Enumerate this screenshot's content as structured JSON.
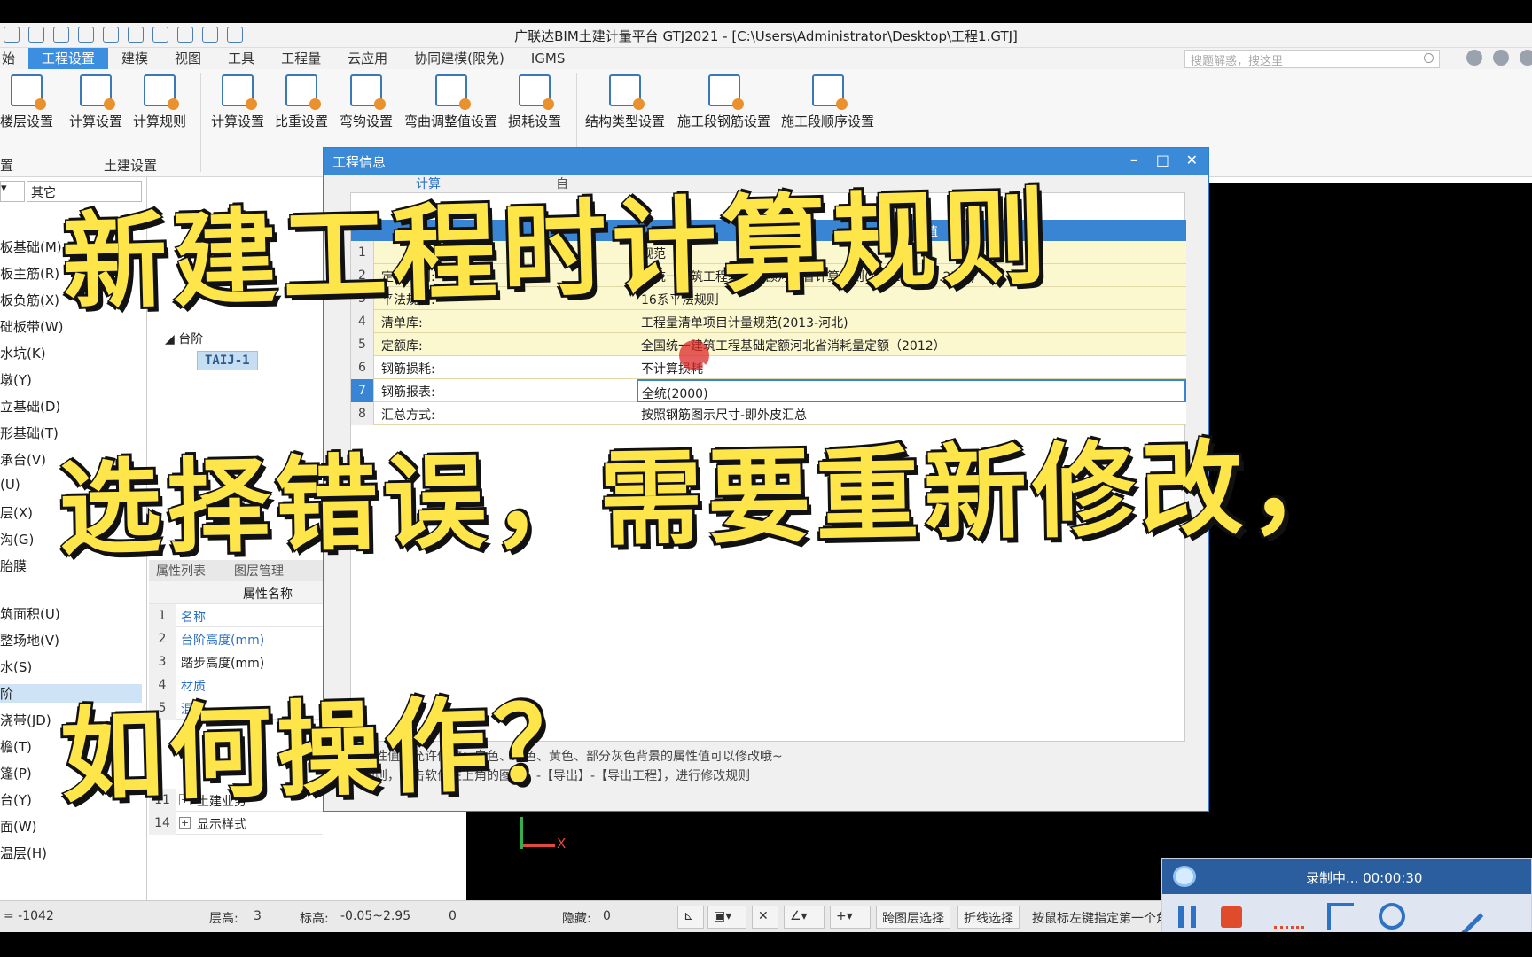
{
  "window": {
    "title": "广联达BIM土建计量平台 GTJ2021 - [C:\\Users\\Administrator\\Desktop\\工程1.GTJ]"
  },
  "menu": {
    "items": [
      "始",
      "工程设置",
      "建模",
      "视图",
      "工具",
      "工程量",
      "云应用",
      "协同建模(限免)",
      "IGMS"
    ],
    "active_index": 1
  },
  "search": {
    "placeholder": "搜题解惑，搜这里"
  },
  "ribbon": {
    "groups": [
      {
        "label": "置",
        "buttons": [
          "楼层设置"
        ]
      },
      {
        "label": "土建设置",
        "buttons": [
          "计算设置",
          "计算规则"
        ]
      },
      {
        "label": "",
        "buttons": [
          "计算设置",
          "比重设置",
          "弯钩设置",
          "弯曲调整值设置",
          "损耗设置"
        ]
      },
      {
        "label": "",
        "buttons": [
          "结构类型设置",
          "施工段钢筋设置",
          "施工段顺序设置"
        ]
      }
    ]
  },
  "left_panel": {
    "combo_value": "其它",
    "items": [
      "板基础(M)",
      "板主筋(R)",
      "板负筋(X)",
      "础板带(W)",
      "水坑(K)",
      "墩(Y)",
      "立基础(D)",
      "形基础(T)",
      "承台(V)",
      "(U)",
      "层(X)",
      "沟(G)",
      "胎膜",
      "筑面积(U)",
      "整场地(V)",
      "水(S)",
      "阶",
      "浇带(JD)",
      "檐(T)",
      "篷(P)",
      "台(Y)",
      "面(W)",
      "温层(H)"
    ],
    "selected_index": 16
  },
  "tree": {
    "parent": "台阶",
    "child": "TAIJ-1"
  },
  "properties": {
    "tabs": [
      "属性列表",
      "图层管理"
    ],
    "header": "属性名称",
    "rows": [
      {
        "num": "1",
        "text": "名称",
        "link": true
      },
      {
        "num": "2",
        "text": "台阶高度(mm)",
        "link": true
      },
      {
        "num": "3",
        "text": "踏步高度(mm)",
        "link": false
      },
      {
        "num": "4",
        "text": "材质",
        "link": true
      },
      {
        "num": "5",
        "text": "混凝",
        "link": true
      },
      {
        "num": "11",
        "text": "土建业务",
        "link": false
      },
      {
        "num": "14",
        "text": "显示样式",
        "link": false
      }
    ]
  },
  "dialog": {
    "title": "工程信息",
    "tabs": [
      "计算",
      "自"
    ],
    "column_value_label": "性值",
    "rows": [
      {
        "num": "1",
        "name": "",
        "value": "规范"
      },
      {
        "num": "2",
        "name": "定额规则:",
        "value": "全统一建筑工程基础定额河北省计算规则(2012)(R1.0.27.2)"
      },
      {
        "num": "3",
        "name": "平法规则:",
        "value": "16系平法规则"
      },
      {
        "num": "4",
        "name": "清单库:",
        "value": "工程量清单项目计量规范(2013-河北)"
      },
      {
        "num": "5",
        "name": "定额库:",
        "value": "全国统一建筑工程基础定额河北省消耗量定额（2012）"
      },
      {
        "num": "6",
        "name": "钢筋损耗:",
        "value": "不计算损耗"
      },
      {
        "num": "7",
        "name": "钢筋报表:",
        "value": "全统(2000)"
      },
      {
        "num": "8",
        "name": "汇总方式:",
        "value": "按照钢筋图示尺寸-即外皮汇总"
      }
    ],
    "yellow_rows": 5,
    "selected_row": 7,
    "note1": "的属性值不允许修改；白色、绿色、黄色、部分灰色背景的属性值可以修改哦~",
    "note2": "算规则，点击软件左上角的图标】-【导出】-【导出工程】，进行修改规则"
  },
  "canvas": {
    "axis_label": "X"
  },
  "statusbar": {
    "coord": "= -1042",
    "floor_height_label": "层高:",
    "floor_height": "3",
    "elevation_label": "标高:",
    "elevation": "-0.05~2.95",
    "zero": "0",
    "hidden_label": "隐藏:",
    "hidden": "0",
    "btn_cross_layer": "跨图层选择",
    "btn_polyline": "折线选择",
    "hint": "按鼠标左键指定第一个角点，或拾取构件图元"
  },
  "recorder": {
    "status": "录制中... 00:00:30"
  },
  "captions": {
    "line1": "新建工程时计算规则",
    "line2": "选择错误，需要重新修改，",
    "line3": "如何操作？"
  },
  "colors": {
    "accent": "#3a85d3",
    "caption": "#fde54a",
    "row_yellow": "#fbf7cf"
  }
}
